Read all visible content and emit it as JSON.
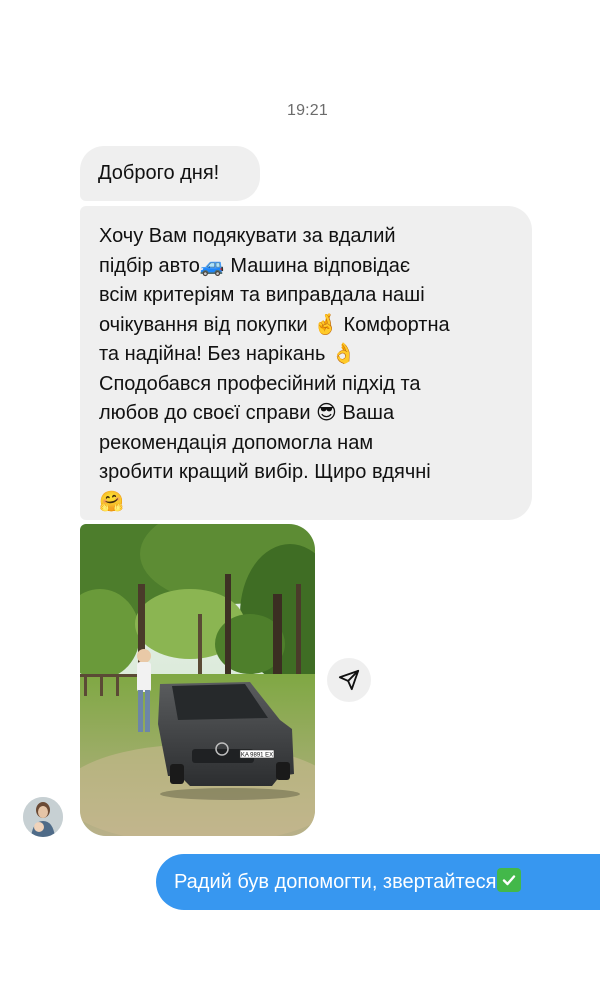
{
  "chat": {
    "timestamp": "19:21",
    "messages": [
      {
        "sender": "contact",
        "text": "Доброго дня!"
      },
      {
        "sender": "contact",
        "text": "Хочу Вам подякувати за вдалий\nпідбір авто🚙 Машина відповідає\nвсім критеріям та виправдала наші\nочікування від покупки 🤞 Комфортна\nта надійна! Без нарікань 👌\nСподобався професійний підхід та\nлюбов до своєї справи 😎 Ваша\nрекомендація допомогла нам\nзробити кращий вибір. Щиро вдячні\n🤗"
      },
      {
        "sender": "me",
        "text": "Радий був допомогти, звертайтеся"
      }
    ],
    "photo_plate": "KA 9891 EX",
    "outgoing_emoji": "check-mark-button",
    "colors": {
      "incoming_bubble": "#efefef",
      "outgoing_bubble": "#3797f0",
      "timestamp": "#6b6b6b"
    },
    "icons": {
      "share": "paper-plane-icon",
      "avatar": "contact-avatar"
    }
  }
}
